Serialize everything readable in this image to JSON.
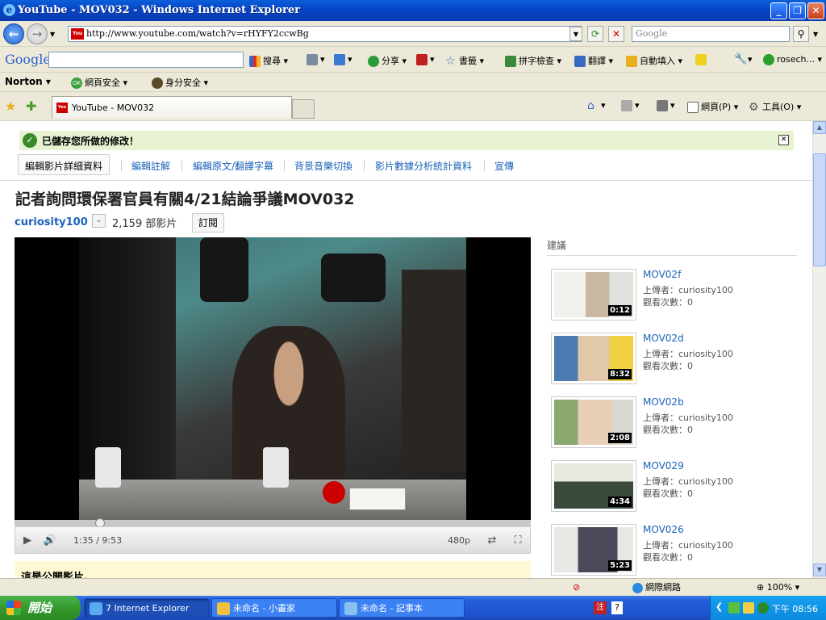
{
  "window": {
    "title": "YouTube - MOV032 - Windows Internet Explorer"
  },
  "nav": {
    "url": "http://www.youtube.com/watch?v=rHYFY2ccwBg",
    "search_placeholder": "Google"
  },
  "googlebar": {
    "logo": "Google",
    "search": "搜尋",
    "share": "分享",
    "bookmarks": "書籤",
    "spellcheck": "拼字檢查",
    "translate": "翻譯",
    "autofill": "自動填入",
    "user": "rosech..."
  },
  "nortonbar": {
    "logo": "Norton",
    "websafety": "網頁安全",
    "identity": "身分安全"
  },
  "tabbar": {
    "tab_label": "YouTube - MOV032",
    "page_menu": "網頁(P)",
    "tools_menu": "工具(O)"
  },
  "page": {
    "saved_message": "已儲存您所做的修改！",
    "editnav": [
      "編輯影片詳細資料",
      "編輯註解",
      "編輯原文/翻譯字幕",
      "背景音樂切換",
      "影片數據分析統計資料",
      "宣傳"
    ],
    "video_title": "記者詢問環保署官員有關4/21結論爭議MOV032",
    "uploader": "curiosity100",
    "video_count": "2,159 部影片",
    "subscribe": "訂閱",
    "time": "1:35 / 9:53",
    "quality": "480p",
    "progress": 0.166,
    "public_note": "這是公開影片。"
  },
  "suggestions": {
    "title": "建議",
    "items": [
      {
        "title": "MOV02f",
        "uploader": "上傳者：curiosity100",
        "views": "觀看次數：0",
        "duration": "0:12"
      },
      {
        "title": "MOV02d",
        "uploader": "上傳者：curiosity100",
        "views": "觀看次數：0",
        "duration": "8:32"
      },
      {
        "title": "MOV02b",
        "uploader": "上傳者：curiosity100",
        "views": "觀看次數：0",
        "duration": "2:08"
      },
      {
        "title": "MOV029",
        "uploader": "上傳者：curiosity100",
        "views": "觀看次數：0",
        "duration": "4:34"
      },
      {
        "title": "MOV026",
        "uploader": "上傳者：curiosity100",
        "views": "觀看次數：0",
        "duration": "5:23"
      }
    ]
  },
  "status": {
    "zone": "網際網路",
    "zoom": "100%"
  },
  "taskbar": {
    "start": "開始",
    "tasks": [
      "7 Internet Explorer",
      "未命名 - 小畫家",
      "未命名 - 記事本"
    ],
    "clock": "下午 08:56"
  }
}
